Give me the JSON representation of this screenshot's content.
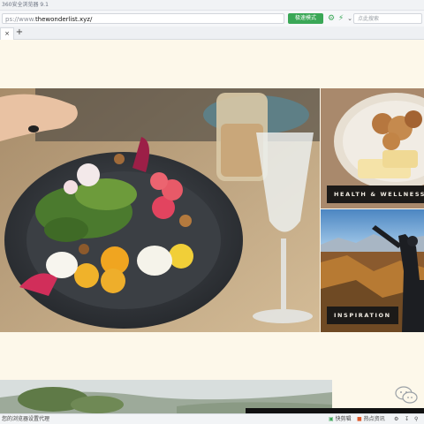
{
  "window": {
    "title": "360安全浏览器 9.1"
  },
  "address_bar": {
    "url_protocol": "ps://www.",
    "url_domain": "thewonderlist.xyz/",
    "speed_label": "极速模式",
    "search_placeholder": "点此搜索"
  },
  "tabs": {
    "new_tab_label": "+"
  },
  "content": {
    "tiles": [
      {
        "label": "HEALTH & WELLNESS"
      },
      {
        "label": "INSPIRATION"
      }
    ]
  },
  "status_bar": {
    "left_text": "您的浏览器设置代理",
    "items": [
      "快剪辑",
      "热点资讯"
    ]
  },
  "colors": {
    "page_bg": "#fdf8ea",
    "speed_badge": "#3aa756",
    "label_box": "#1c1a18"
  }
}
